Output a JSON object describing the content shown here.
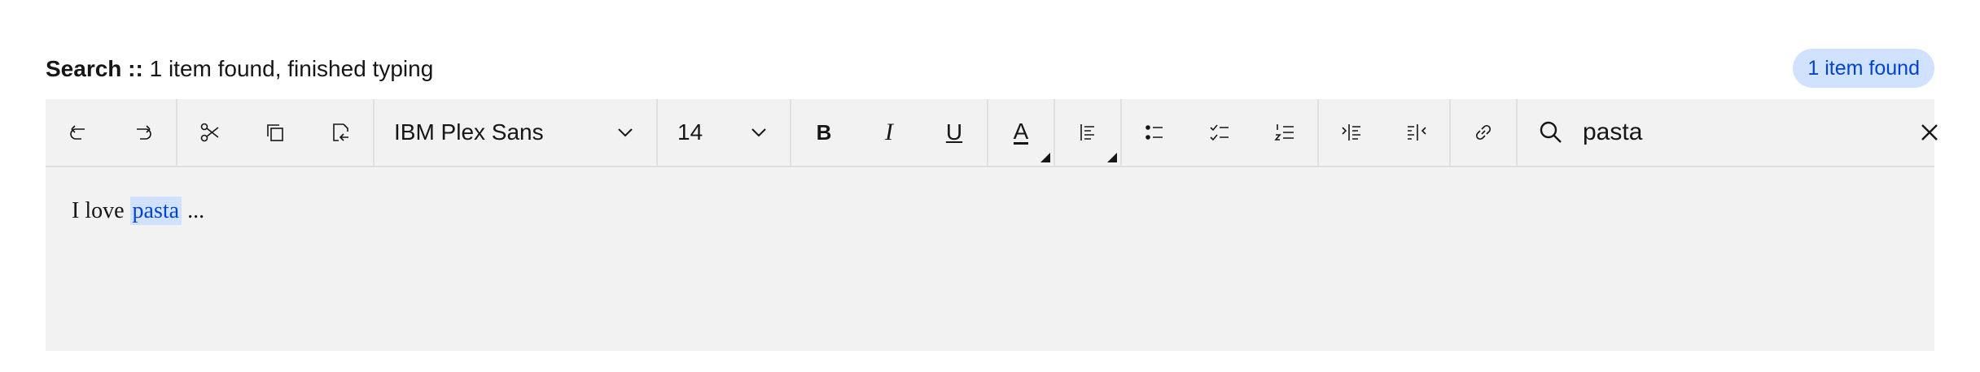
{
  "status": {
    "prefix": "Search ::",
    "text": "1 item found, finished typing",
    "badge": "1 item found"
  },
  "toolbar": {
    "font_family": "IBM Plex Sans",
    "font_size": "14",
    "bold_glyph": "B",
    "italic_glyph": "I",
    "underline_glyph": "U",
    "text_color_glyph": "A"
  },
  "search": {
    "value": "pasta"
  },
  "content": {
    "before": "I love ",
    "match": "pasta",
    "after": " ..."
  },
  "colors": {
    "accent": "#0043ce",
    "highlight_bg": "#d0e2ff",
    "editor_bg": "#f2f2f2"
  }
}
